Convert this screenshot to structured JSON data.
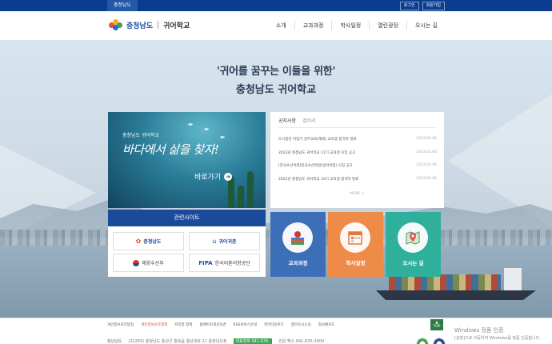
{
  "topbar": {
    "home_label": "충청남도",
    "links": [
      "로그인",
      "회원가입"
    ]
  },
  "header": {
    "logo_region": "충청남도",
    "logo_school": "귀어학교",
    "nav": [
      "소개",
      "교과과정",
      "학사일정",
      "열린광장",
      "오시는 길"
    ]
  },
  "hero": {
    "headline_line1": "'귀어를 꿈꾸는 이들을 위한'",
    "headline_line2": "충청남도 귀어학교"
  },
  "banner": {
    "subtitle": "충청남도 귀어학교",
    "main": "바다에서 삶을 찾자!",
    "cta": "바로가기"
  },
  "notice": {
    "tabs": [
      "공지사항",
      "갤러리"
    ],
    "items": [
      {
        "title": "도시청년 어업가 실무교육(해외) 교육생 합격자 발표",
        "date": "2023.02.06"
      },
      {
        "title": "2023년 충청남도 귀어학교 11기 교육생 모집 공고",
        "date": "2023.02.06"
      },
      {
        "title": "[한국수산어촌]한국수산연합(방어어업) 모집 공고",
        "date": "2023.02.06"
      },
      {
        "title": "2022년 충청남도 귀어학교 10기 교육생 합격자 발표",
        "date": "2023.02.06"
      }
    ],
    "more": "MORE +"
  },
  "related": {
    "title": "관련사이트",
    "sites": [
      {
        "name": "충청남도",
        "icon": "chungnam-flower-icon"
      },
      {
        "name": "귀어귀촌",
        "icon": "house-icon"
      },
      {
        "name": "해양수산부",
        "icon": "taegeuk-icon"
      },
      {
        "name": "한국어촌어항공단",
        "icon": "fipa-logo"
      }
    ],
    "fipa_mark": "FIPA"
  },
  "quick": [
    {
      "label": "교과과정",
      "icon": "book-apple-icon",
      "color": "#3c6fb8"
    },
    {
      "label": "학사일정",
      "icon": "calendar-icon",
      "color": "#ef8b49"
    },
    {
      "label": "오시는 길",
      "icon": "map-pin-icon",
      "color": "#2fb09c"
    }
  ],
  "footer": {
    "links": [
      "개인정보처리방침",
      "개인정보보호정책",
      "저작권 정책",
      "홈페이지개선의견",
      "RSS서비스안내",
      "뷰어다운로드",
      "찾아오시는길",
      "청사배치도"
    ],
    "addr_logo": "충남남도",
    "addr": "(32255) 충청남도 홍성군 홍북읍 충남대로 21 충청남도청",
    "phone_badge": "대표전화 041-635-",
    "fax": "민원 팩스 041-635-3000",
    "top_label": "TOP"
  },
  "os_overlay": {
    "title": "Windows 정품 인증",
    "desc": "[설정]으로 이동하여 Windows를 정품 인증합니다."
  }
}
